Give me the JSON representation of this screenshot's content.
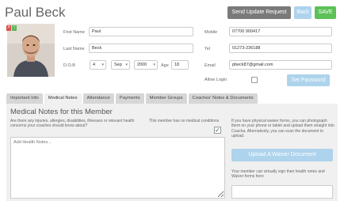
{
  "header": {
    "name": "Paul Beck",
    "send_update_label": "Send Update Request",
    "back_label": "Back",
    "save_label": "SAVE"
  },
  "form": {
    "first_name_label": "First Name",
    "first_name_value": "Paul",
    "last_name_label": "Last Name",
    "last_name_value": "Beck",
    "dob_label": "D.O.B",
    "dob_day": "4",
    "dob_month": "Sep",
    "dob_year": "2000",
    "age_label": "Age",
    "age_value": "18",
    "mobile_label": "Mobile",
    "mobile_value": "07700 900417",
    "tel_label": "Tel",
    "tel_value": "01273-236188",
    "email_label": "Email",
    "email_value": "pbeck87@gmail.com",
    "allow_login_label": "Allow Login",
    "allow_login_checked": false,
    "set_password_label": "Set Password"
  },
  "tabs": [
    {
      "label": "Important Info",
      "active": false
    },
    {
      "label": "Medical Notes",
      "active": true
    },
    {
      "label": "Attendance",
      "active": false
    },
    {
      "label": "Payments",
      "active": false
    },
    {
      "label": "Member Groups",
      "active": false
    },
    {
      "label": "Coaches' Notes & Documents",
      "active": false
    }
  ],
  "medical": {
    "title": "Medical Notes for this Member",
    "question": "Are there any injuries, allergies, disabilities, illnesses or relevant health concerns your coaches should know about?",
    "no_conditions_label": "This member has no medical conditions",
    "no_conditions_checked": true,
    "health_placeholder": "Add Health Notes...",
    "waiver_text": "If you have physical waiver forms, you can photograph them on your phone or tablet and upload them straight into Coacha. Alternatively, you can scan the document to upload.",
    "upload_label": "Upload A Waiver Document",
    "virtual_text": "Your member can virtually sign their health notes and Waiver forms here"
  },
  "colors": {
    "accent_light_blue": "#aed3ec",
    "save_green": "#5cc157",
    "send_grey": "#7a7a7a"
  }
}
